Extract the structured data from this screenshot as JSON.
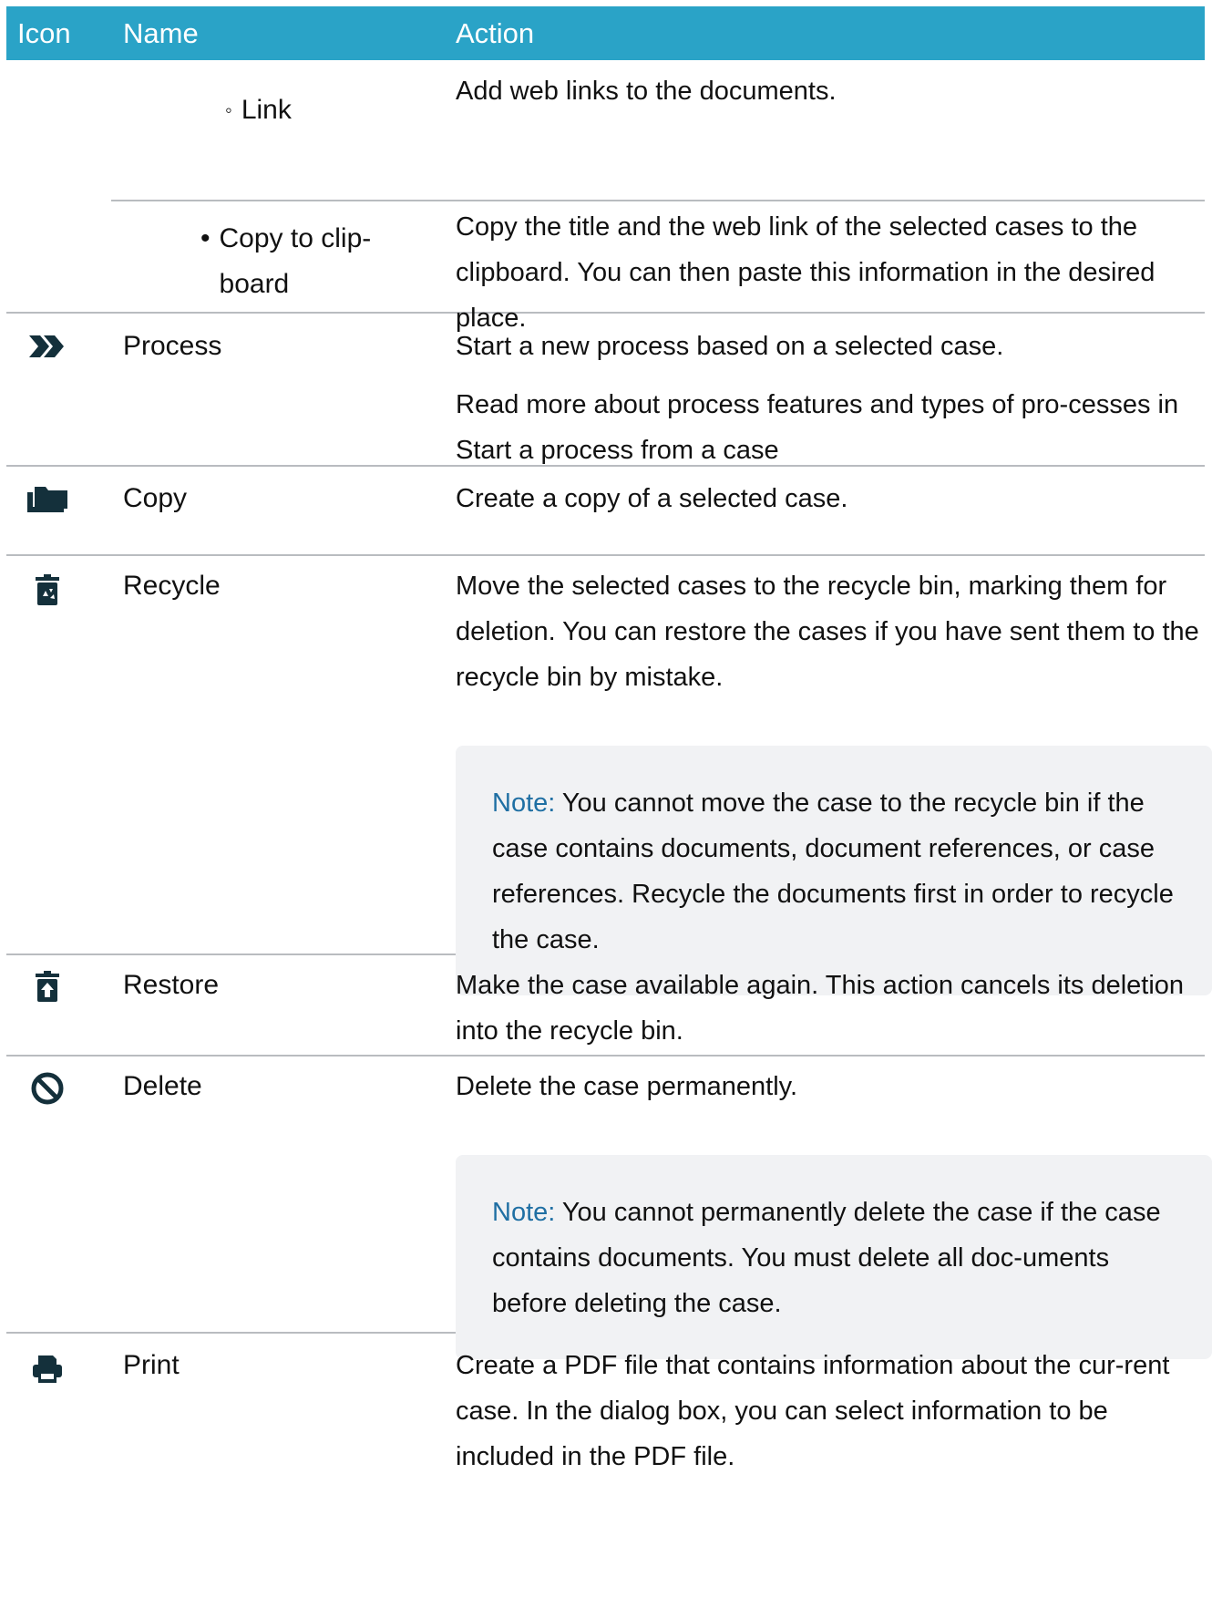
{
  "header": {
    "col_icon": "Icon",
    "col_name": "Name",
    "col_action": "Action"
  },
  "rows": {
    "link": {
      "bullet": "◦",
      "name": "Link",
      "action": "Add web links to the documents."
    },
    "copy_clipboard": {
      "bullet": "•",
      "name_line1": "Copy to clip-",
      "name_line2": "board",
      "action": "Copy the title and the web link of the selected cases to the clipboard. You can then paste this information in the desired place."
    },
    "process": {
      "icon": "double-chevron-right-icon",
      "name": "Process",
      "action_p1": "Start a new process based on a selected case.",
      "action_p2": "Read more about process features and types of pro-cesses in  Start a process from a case"
    },
    "copy": {
      "icon": "folder-copy-icon",
      "name": "Copy",
      "action": "Create a copy of a selected case."
    },
    "recycle": {
      "icon": "recycle-bin-icon",
      "name": "Recycle",
      "action": "Move the selected cases to the recycle bin, marking them for deletion. You can restore the cases if you have sent them to the recycle bin by mistake.",
      "note_label": "Note:",
      "note_text": " You cannot move the case to the recycle bin if the case contains documents, document references, or case references. Recycle the documents first in order to recycle the case."
    },
    "restore": {
      "icon": "restore-bin-icon",
      "name": "Restore",
      "action": "Make the case available again. This action cancels its deletion into the recycle bin."
    },
    "delete": {
      "icon": "prohibited-icon",
      "name": "Delete",
      "action": "Delete the case permanently.",
      "note_label": "Note:",
      "note_text": " You cannot permanently delete the case if the case contains documents. You must delete all doc-uments before deleting the case."
    },
    "print": {
      "icon": "printer-icon",
      "name": "Print",
      "action": "Create a PDF file that contains information about the cur-rent case. In the dialog box, you can select information to be included in the PDF file."
    }
  },
  "colors": {
    "header_bg": "#2aa3c7",
    "note_bg": "#f1f2f4",
    "note_label": "#1f6fa3",
    "icon": "#14303b"
  }
}
